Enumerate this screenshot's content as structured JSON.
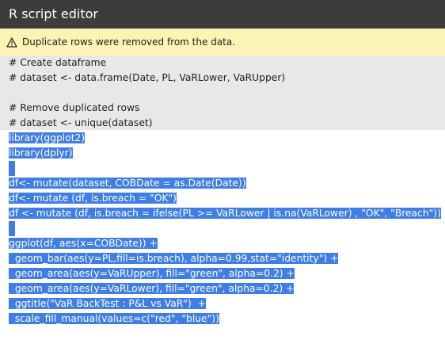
{
  "window": {
    "title": "R script editor"
  },
  "warning": {
    "icon": "warning-triangle-icon",
    "text": "Duplicate rows were removed from the data."
  },
  "colors": {
    "titlebar": "#3c3c3b",
    "warning_bg": "#faf5b4",
    "comment_bg": "#e8e8e8",
    "selection": "#3f7ee6"
  },
  "code": {
    "lines": [
      {
        "text": "# Create dataframe",
        "selected": false
      },
      {
        "text": "# dataset <- data.frame(Date, PL, VaRLower, VaRUpper)",
        "selected": false
      },
      {
        "text": "",
        "selected": false
      },
      {
        "text": "# Remove duplicated rows",
        "selected": false
      },
      {
        "text": "# dataset <- unique(dataset)",
        "selected": false
      },
      {
        "text": "library(ggplot2)",
        "selected": true
      },
      {
        "text": "library(dplyr)",
        "selected": true
      },
      {
        "text": "",
        "selected": true
      },
      {
        "text": "df<- mutate(dataset, COBDate = as.Date(Date))",
        "selected": true
      },
      {
        "text": "df<- mutate (df, is.breach = \"OK\")",
        "selected": true
      },
      {
        "text": "df <- mutate (df, is.breach = ifelse(PL >= VaRLower | is.na(VaRLower) , \"OK\", \"Breach\"))",
        "selected": true
      },
      {
        "text": "",
        "selected": true
      },
      {
        "text": "ggplot(df, aes(x=COBDate)) +",
        "selected": true
      },
      {
        "text": "  geom_bar(aes(y=PL,fill=is.breach), alpha=0.99,stat=\"identity\") +",
        "selected": true
      },
      {
        "text": "  geom_area(aes(y=VaRUpper), fill=\"green\", alpha=0.2) +",
        "selected": true
      },
      {
        "text": "  geom_area(aes(y=VaRLower), fill=\"green\", alpha=0.2) +",
        "selected": true
      },
      {
        "text": "  ggtitle(\"VaR BackTest : P&L vs VaR\")  +",
        "selected": true
      },
      {
        "text": "  scale_fill_manual(values=c(\"red\", \"blue\"))",
        "selected": true
      }
    ]
  }
}
